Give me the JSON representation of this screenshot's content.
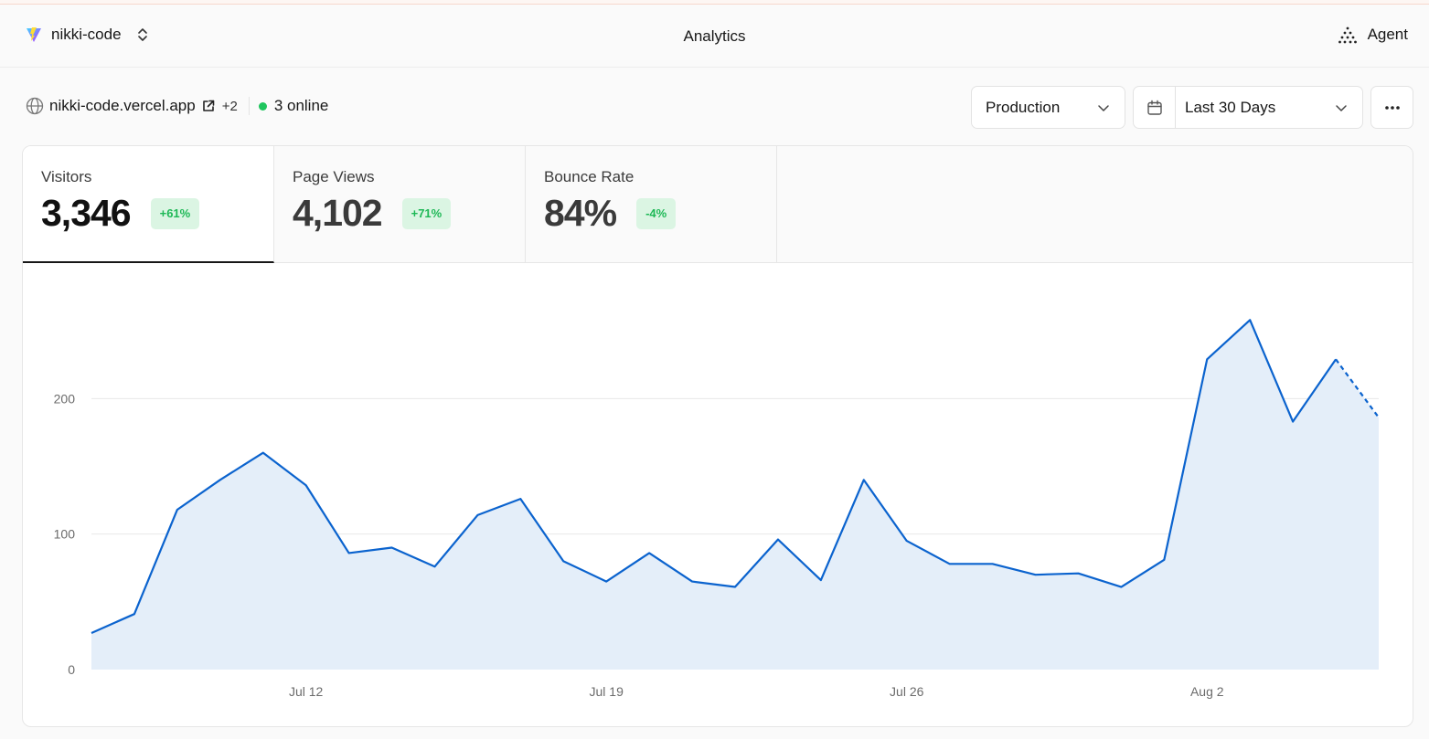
{
  "header": {
    "project_name": "nikki-code",
    "page_title": "Analytics",
    "agent_label": "Agent"
  },
  "site": {
    "domain": "nikki-code.vercel.app",
    "extra_domains": "+2",
    "online": "3 online"
  },
  "filters": {
    "environment": "Production",
    "range": "Last 30 Days"
  },
  "tabs": [
    {
      "label": "Visitors",
      "value": "3,346",
      "change": "+61%"
    },
    {
      "label": "Page Views",
      "value": "4,102",
      "change": "+71%"
    },
    {
      "label": "Bounce Rate",
      "value": "84%",
      "change": "-4%"
    }
  ],
  "colors": {
    "accent": "#0b63ce",
    "area_fill": "#e4eef9",
    "positive": "#1eb856"
  },
  "chart_data": {
    "type": "area",
    "series": [
      {
        "values": [
          27,
          41,
          118,
          140,
          160,
          136,
          86,
          90,
          76,
          114,
          126,
          80,
          65,
          86,
          65,
          61,
          96,
          66,
          140,
          95,
          78,
          78,
          70,
          71,
          61,
          81,
          229,
          258,
          183,
          229,
          186
        ]
      }
    ],
    "dashed_last_segment": true,
    "x_ticks": [
      {
        "index": 5,
        "label": "Jul 12"
      },
      {
        "index": 12,
        "label": "Jul 19"
      },
      {
        "index": 19,
        "label": "Jul 26"
      },
      {
        "index": 26,
        "label": "Aug 2"
      }
    ],
    "y_ticks": [
      0,
      100,
      200
    ],
    "ylim": [
      0,
      300
    ],
    "grid": true
  }
}
